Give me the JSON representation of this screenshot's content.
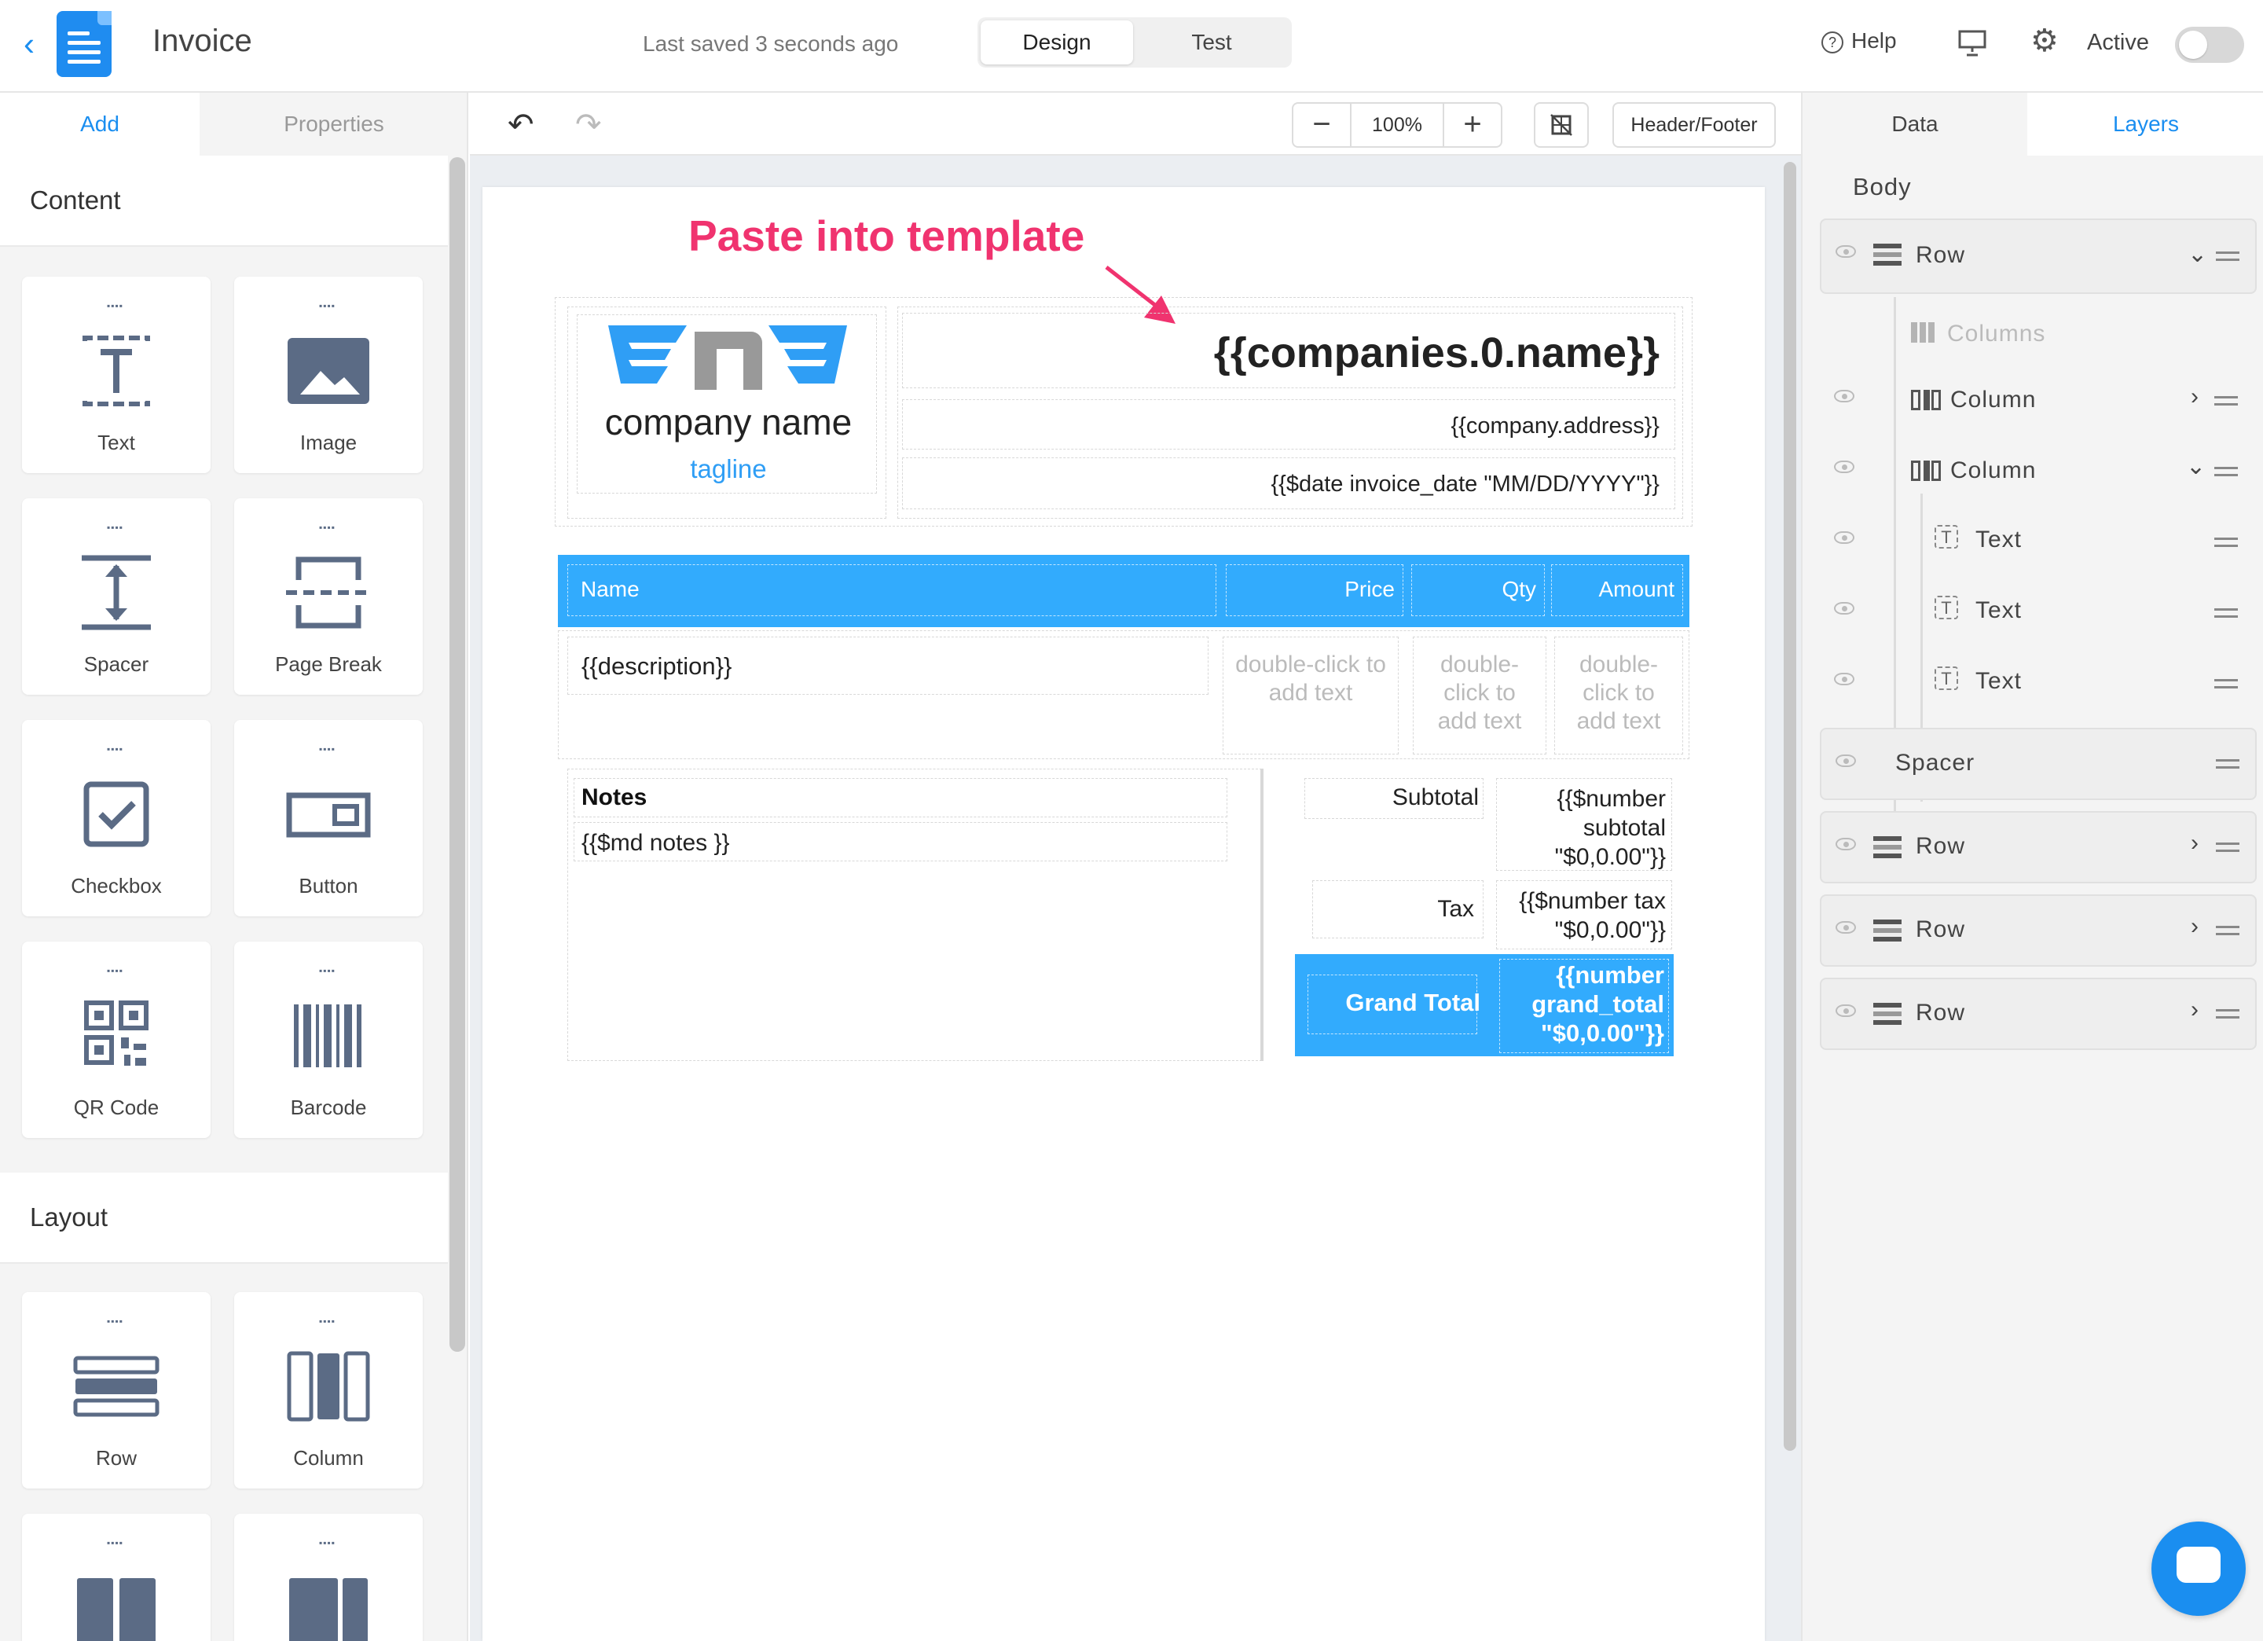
{
  "topbar": {
    "title": "Invoice",
    "saved_status": "Last saved 3 seconds ago",
    "modes": [
      "Design",
      "Test"
    ],
    "active_mode": "Design",
    "help_label": "Help",
    "active_label": "Active",
    "active_toggle_on": false
  },
  "left_panel": {
    "tabs": [
      "Add",
      "Properties"
    ],
    "active_tab": "Add",
    "content_title": "Content",
    "content_items": [
      "Text",
      "Image",
      "Spacer",
      "Page Break",
      "Checkbox",
      "Button",
      "QR Code",
      "Barcode"
    ],
    "layout_title": "Layout",
    "layout_items": [
      "Row",
      "Column"
    ]
  },
  "toolbar": {
    "zoom": "100%",
    "header_footer_label": "Header/Footer"
  },
  "invoice": {
    "annotation": "Paste into template",
    "company_name": "company name",
    "tagline": "tagline",
    "companies_field": "{{companies.0.name}}",
    "address_field": "{{company.address}}",
    "date_field": "{{$date invoice_date \"MM/DD/YYYY\"}}",
    "columns": [
      "Name",
      "Price",
      "Qty",
      "Amount"
    ],
    "description_field": "{{description}}",
    "placeholder_1": "double-click to add text",
    "placeholder_2": "double-click to add text",
    "placeholder_3": "double-click to add text",
    "notes_label": "Notes",
    "notes_field": "{{$md notes }}",
    "subtotal_label": "Subtotal",
    "subtotal_field": "{{$number subtotal \"$0,0.00\"}}",
    "tax_label": "Tax",
    "tax_field": "{{$number tax \"$0,0.00\"}}",
    "grand_total_label": "Grand Total",
    "grand_total_field": "{{number grand_total \"$0,0.00\"}}",
    "accent_color": "#32abfd",
    "annotation_color": "#f0336f"
  },
  "right_panel": {
    "tabs": [
      "Data",
      "Layers"
    ],
    "active_tab": "Layers",
    "body_label": "Body",
    "layers": {
      "row1": "Row",
      "columns": "Columns",
      "column1": "Column",
      "column2": "Column",
      "text1": "Text",
      "text2": "Text",
      "text3": "Text",
      "spacer": "Spacer",
      "row2": "Row",
      "row3": "Row",
      "row4": "Row"
    }
  }
}
